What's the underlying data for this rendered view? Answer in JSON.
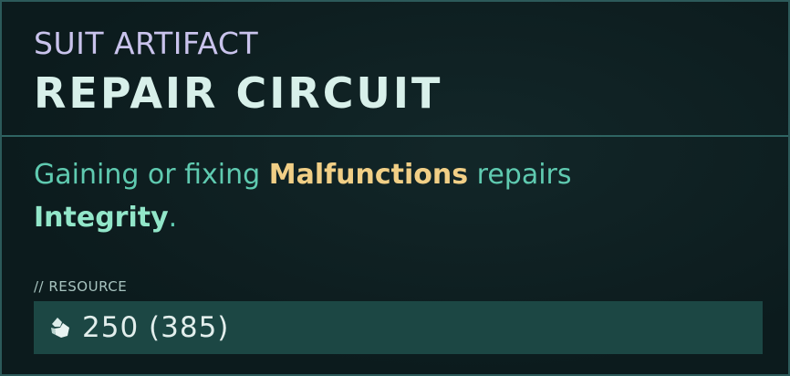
{
  "card": {
    "category": "SUIT ARTIFACT",
    "title": "REPAIR CIRCUIT",
    "description": {
      "part1": "Gaining or fixing ",
      "highlight1": "Malfunctions",
      "part2": " repairs ",
      "highlight2": "Integrity",
      "part3": "."
    },
    "resource_label": "// RESOURCE",
    "resource_icon": "crystal-icon",
    "resource_value": "250 (385)"
  },
  "colors": {
    "background": "#0c1b1d",
    "border": "#2c5a5a",
    "category": "#c9c3ec",
    "title": "#d8f0ea",
    "description": "#5fcab0",
    "highlight_gold": "#f1cf86",
    "highlight_teal": "#92e6c9",
    "resource_bar": "#1c4744"
  }
}
